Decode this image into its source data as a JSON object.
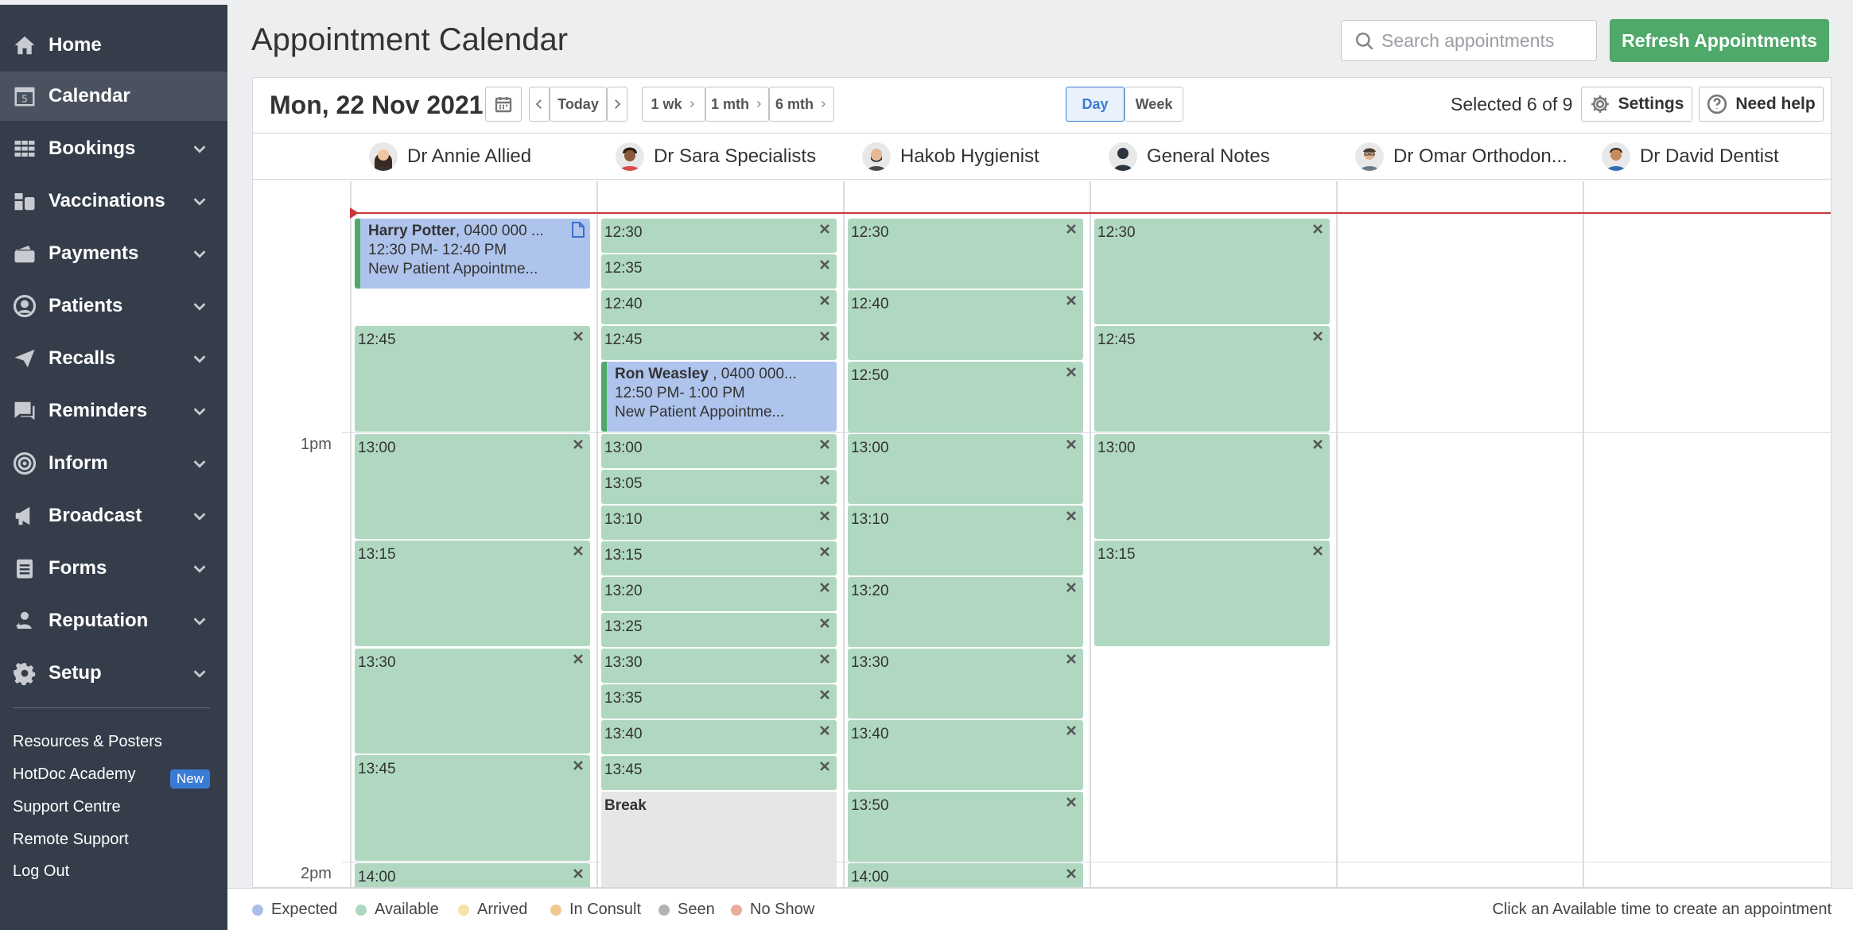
{
  "sidebar": {
    "items": [
      {
        "label": "Home",
        "icon": "home-icon"
      },
      {
        "label": "Calendar",
        "icon": "calendar-icon",
        "icon_text": "5"
      },
      {
        "label": "Bookings",
        "icon": "bookings-grid-icon"
      },
      {
        "label": "Vaccinations",
        "icon": "vaccination-icon"
      },
      {
        "label": "Payments",
        "icon": "wallet-icon"
      },
      {
        "label": "Patients",
        "icon": "user-circle-icon"
      },
      {
        "label": "Recalls",
        "icon": "paper-plane-icon"
      },
      {
        "label": "Reminders",
        "icon": "chat-bubble-icon"
      },
      {
        "label": "Inform",
        "icon": "target-icon"
      },
      {
        "label": "Broadcast",
        "icon": "megaphone-icon"
      },
      {
        "label": "Forms",
        "icon": "clipboard-icon"
      },
      {
        "label": "Reputation",
        "icon": "star-user-icon"
      },
      {
        "label": "Setup",
        "icon": "gear-icon"
      }
    ],
    "links": [
      "Resources & Posters",
      "HotDoc Academy",
      "Support Centre",
      "Remote Support",
      "Log Out"
    ],
    "new_badge": "New"
  },
  "header": {
    "title": "Appointment Calendar",
    "search_placeholder": "Search appointments",
    "refresh_label": "Refresh Appointments"
  },
  "toolbar": {
    "date": "Mon, 22 Nov 2021",
    "today": "Today",
    "one_week": "1 wk",
    "one_month": "1 mth",
    "six_month": "6 mth",
    "day": "Day",
    "week": "Week",
    "selected": "Selected 6 of 9",
    "settings": "Settings",
    "help": "Need help"
  },
  "providers": [
    "Dr Annie Allied",
    "Dr Sara Specialists",
    "Hakob Hygienist",
    "General Notes",
    "Dr Omar Orthodon...",
    "Dr David Dentist"
  ],
  "hours": [
    "1pm",
    "2pm"
  ],
  "columns": {
    "annie": {
      "appointment": {
        "name": "Harry Potter",
        "phone": ", 0400 000 ...",
        "time": "12:30 PM- 12:40 PM",
        "type": "New Patient Appointme..."
      },
      "slots": [
        "12:45",
        "13:00",
        "13:15",
        "13:30",
        "13:45",
        "14:00"
      ]
    },
    "sara": {
      "slots_before": [
        "12:30",
        "12:35",
        "12:40",
        "12:45"
      ],
      "appointment": {
        "name": "Ron Weasley ",
        "phone": ", 0400 000...",
        "time": "12:50 PM- 1:00 PM",
        "type": "New Patient Appointme..."
      },
      "slots_after": [
        "13:00",
        "13:05",
        "13:10",
        "13:15",
        "13:20",
        "13:25",
        "13:30",
        "13:35",
        "13:40",
        "13:45"
      ],
      "break": "Break"
    },
    "hakob": {
      "slots": [
        "12:30",
        "12:40",
        "12:50",
        "13:00",
        "13:10",
        "13:20",
        "13:30",
        "13:40",
        "13:50",
        "14:00"
      ]
    },
    "general": {
      "slots": [
        "12:30",
        "12:45",
        "13:00",
        "13:15"
      ]
    }
  },
  "legend": {
    "items": [
      {
        "label": "Expected",
        "color": "#a9bfe8"
      },
      {
        "label": "Available",
        "color": "#afd8c0"
      },
      {
        "label": "Arrived",
        "color": "#f3e3a6"
      },
      {
        "label": "In Consult",
        "color": "#f1c98e"
      },
      {
        "label": "Seen",
        "color": "#b3b3b6"
      },
      {
        "label": "No Show",
        "color": "#e9ad9c"
      }
    ],
    "hint": "Click an Available time to create an appointment"
  },
  "colors": {
    "sidebar": "#353d4a",
    "available": "#b0d8c1",
    "expected": "#afc4ec",
    "accent_green": "#4fa96a",
    "now_line": "#c8373a"
  }
}
